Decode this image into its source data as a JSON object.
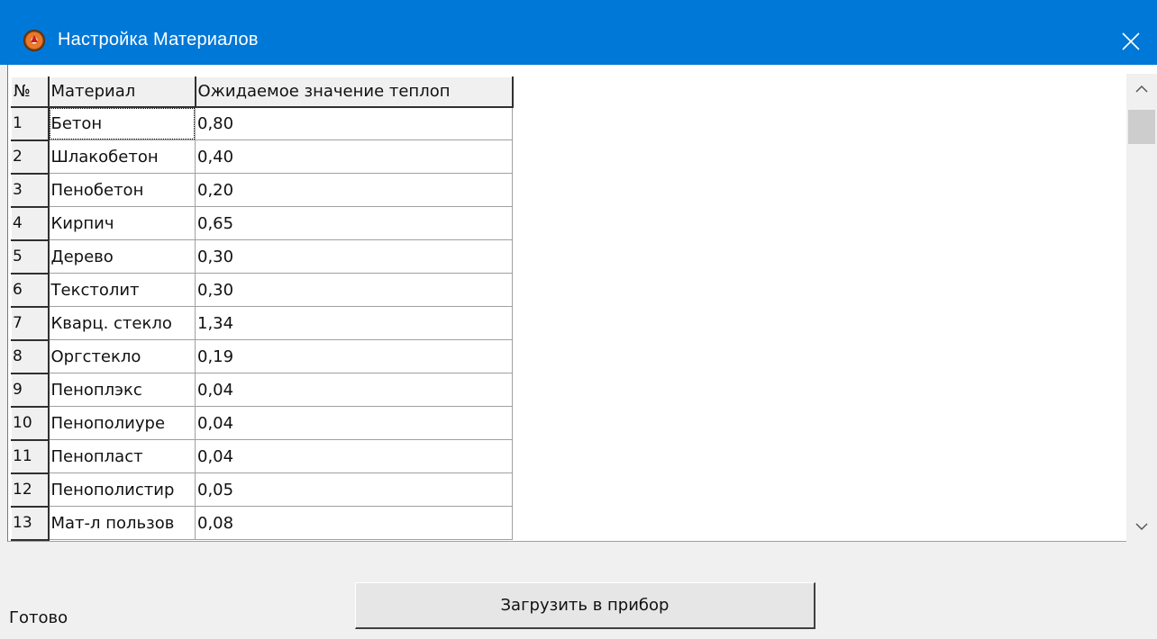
{
  "window": {
    "title": "Настройка Материалов",
    "close_icon": "close-icon",
    "app_icon": "app-icon"
  },
  "grid": {
    "headers": [
      "№",
      "Материал",
      "Ожидаемое значение теплоп"
    ],
    "rows": [
      {
        "num": "1",
        "material": "Бетон",
        "value": "0,80"
      },
      {
        "num": "2",
        "material": "Шлакобетон",
        "value": "0,40"
      },
      {
        "num": "3",
        "material": "Пенобетон",
        "value": "0,20"
      },
      {
        "num": "4",
        "material": "Кирпич",
        "value": "0,65"
      },
      {
        "num": "5",
        "material": "Дерево",
        "value": "0,30"
      },
      {
        "num": "6",
        "material": "Текстолит",
        "value": "0,30"
      },
      {
        "num": "7",
        "material": "Кварц. стекло",
        "value": "1,34"
      },
      {
        "num": "8",
        "material": "Оргстекло",
        "value": "0,19"
      },
      {
        "num": "9",
        "material": "Пеноплэкс",
        "value": "0,04"
      },
      {
        "num": "10",
        "material": "Пенополиуре",
        "value": "0,04"
      },
      {
        "num": "11",
        "material": "Пенопласт",
        "value": "0,04"
      },
      {
        "num": "12",
        "material": "Пенополистир",
        "value": "0,05"
      },
      {
        "num": "13",
        "material": "Мат-л пользов",
        "value": "0,08"
      }
    ]
  },
  "status": {
    "text": "Готово"
  },
  "actions": {
    "load_label": "Загрузить в прибор"
  },
  "colors": {
    "titlebar": "#0078d7",
    "background": "#f0f0f0"
  }
}
